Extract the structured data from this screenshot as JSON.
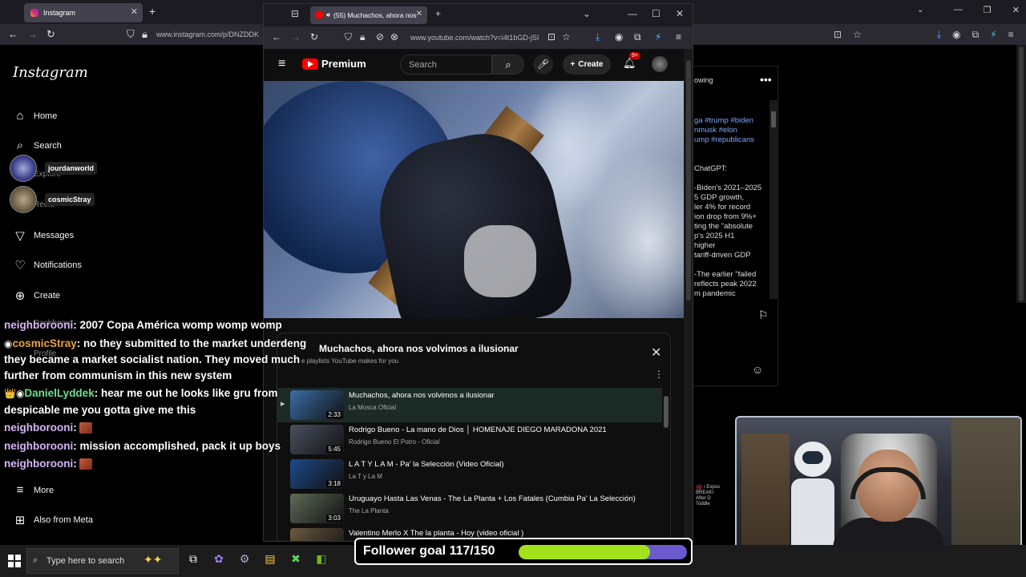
{
  "instagram_browser": {
    "tab_title": "Instagram",
    "url": "www.instagram.com/p/DNZDDK"
  },
  "instagram_sidebar": {
    "logo": "Instagram",
    "items": [
      {
        "label": "Home",
        "icon": "home-icon"
      },
      {
        "label": "Search",
        "icon": "search-icon"
      },
      {
        "label": "Explore",
        "icon": "compass-icon"
      },
      {
        "label": "Reels",
        "icon": "reels-icon"
      },
      {
        "label": "Messages",
        "icon": "send-icon"
      },
      {
        "label": "Notifications",
        "icon": "heart-icon"
      },
      {
        "label": "Create",
        "icon": "plus-icon"
      },
      {
        "label": "Dashboard",
        "icon": "dashboard-icon"
      },
      {
        "label": "Profile",
        "icon": "profile-icon"
      },
      {
        "label": "More",
        "icon": "menu-icon"
      },
      {
        "label": "Also from Meta",
        "icon": "meta-icon"
      }
    ],
    "stories": [
      {
        "user": "jourdanworld"
      },
      {
        "user": "cosmicStray"
      }
    ]
  },
  "instagram_post": {
    "follow_text": "owing",
    "hashtags": [
      "ga #trump #biden",
      "nmusk #elon",
      "ump #republicans"
    ],
    "body": "ChatGPT:\n\n-Biden's 2021–2025\n5 GDP growth,\nler 4% for record\nion drop from 9%+\nting the \"absolute\np's 2025 H1\nhigher\ntariff-driven GDP\n\n-The earlier \"failed\nreflects peak 2022\nm pandemic"
  },
  "youtube_browser": {
    "tab_title": "(55) Muchachos, ahora nos",
    "url": "www.youtube.com/watch?v=i4t1bGD-jSI",
    "logo": "Premium",
    "search_placeholder": "Search",
    "create_label": "Create",
    "notifications_badge": "9+"
  },
  "playlist": {
    "title": "Muchachos, ahora nos volvimos a ilusionar",
    "subtitle": "e playlists YouTube makes for you",
    "items": [
      {
        "title": "Muchachos, ahora nos volvimos a ilusionar",
        "channel": "La Mosca Oficial",
        "duration": "2:33",
        "thumb_color": "#3a6ea8",
        "active": true
      },
      {
        "title": "Rodrigo Bueno - La mano de Dios │ HOMENAJE DIEGO MARADONA 2021",
        "channel": "Rodrigo Bueno El Potro - Oficial",
        "duration": "5:45",
        "thumb_color": "#4a5260",
        "active": false
      },
      {
        "title": "L A T Y L A M - Pa' la Selección (Video Oficial)",
        "channel": "La T y La M",
        "duration": "3:18",
        "thumb_color": "#1e4a8a",
        "active": false
      },
      {
        "title": "Uruguayo Hasta Las Venas - The La Planta + Los Fatales (Cumbia Pa' La Selección)",
        "channel": "The La Planta",
        "duration": "3:03",
        "thumb_color": "#5e6b58",
        "active": false
      },
      {
        "title": "Valentino Merlo X The la planta - Hoy (video oficial )",
        "channel": "",
        "duration": "",
        "thumb_color": "#6b5a40",
        "active": false
      }
    ]
  },
  "chat": [
    {
      "user": "neighborooni",
      "message": "2007 Copa América womp womp womp",
      "color_class": "u1",
      "badges": "",
      "emote": false
    },
    {
      "user": "cosmicStray",
      "message": "no they submitted to the market underdeng they became a market socialist nation. They moved much further from communism in this new system",
      "color_class": "u2",
      "badges": "◉",
      "emote": false
    },
    {
      "user": "DanielLyddek",
      "message": "hear me out he looks like gru from despicable me you gotta give me this",
      "color_class": "u3",
      "badges": "👑◉",
      "emote": false
    },
    {
      "user": "neighborooni",
      "message": "",
      "color_class": "u1",
      "badges": "",
      "emote": true
    },
    {
      "user": "neighborooni",
      "message": "mission accomplished, pack it up boys",
      "color_class": "u1",
      "badges": "",
      "emote": false
    },
    {
      "user": "neighborooni",
      "message": "",
      "color_class": "u1",
      "badges": "",
      "emote": true
    }
  ],
  "taskbar": {
    "search_placeholder": "Type here to search"
  },
  "follower_goal": {
    "label": "Follower goal 117/150",
    "current": 117,
    "target": 150
  },
  "colors": {
    "goal_fill": "#a3e21a",
    "goal_track": "#6a5acd",
    "youtube_red": "#ff0000"
  }
}
